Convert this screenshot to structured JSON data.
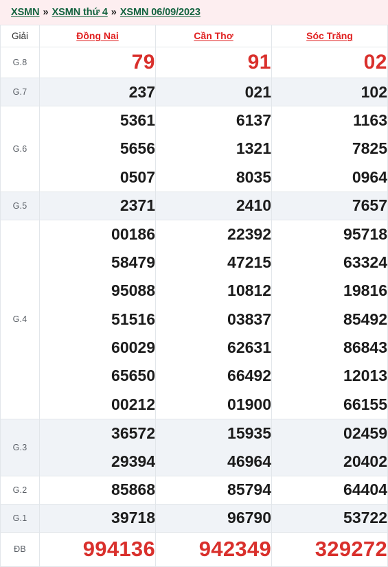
{
  "breadcrumb": {
    "items": [
      "XSMN",
      "XSMN thứ 4",
      "XSMN 06/09/2023"
    ],
    "separator": "»"
  },
  "colors": {
    "breadcrumb_bg": "#fdeef0",
    "breadcrumb_link": "#14633f",
    "province_link": "#e02020",
    "highlight_number": "#d9302c",
    "number": "#1c1c1c",
    "alt_row_bg": "#f0f3f7",
    "border": "#e2e6ea"
  },
  "table": {
    "headers": {
      "grade": "Giải",
      "provinces": [
        "Đồng Nai",
        "Cần Thơ",
        "Sóc Trăng"
      ]
    },
    "rows": [
      {
        "grade": "G.8",
        "values": {
          "dong_nai": "79",
          "can_tho": "91",
          "soc_trang": "02"
        }
      },
      {
        "grade": "G.7",
        "values": {
          "dong_nai": "237",
          "can_tho": "021",
          "soc_trang": "102"
        }
      },
      {
        "grade": "G.6",
        "values": {
          "dong_nai": "5361\n5656\n0507",
          "can_tho": "6137\n1321\n8035",
          "soc_trang": "1163\n7825\n0964"
        }
      },
      {
        "grade": "G.5",
        "values": {
          "dong_nai": "2371",
          "can_tho": "2410",
          "soc_trang": "7657"
        }
      },
      {
        "grade": "G.4",
        "values": {
          "dong_nai": "00186\n58479\n95088\n51516\n60029\n65650\n00212",
          "can_tho": "22392\n47215\n10812\n03837\n62631\n66492\n01900",
          "soc_trang": "95718\n63324\n19816\n85492\n86843\n12013\n66155"
        }
      },
      {
        "grade": "G.3",
        "values": {
          "dong_nai": "36572\n29394",
          "can_tho": "15935\n46964",
          "soc_trang": "02459\n20402"
        }
      },
      {
        "grade": "G.2",
        "values": {
          "dong_nai": "85868",
          "can_tho": "85794",
          "soc_trang": "64404"
        }
      },
      {
        "grade": "G.1",
        "values": {
          "dong_nai": "39718",
          "can_tho": "96790",
          "soc_trang": "53722"
        }
      },
      {
        "grade": "ĐB",
        "values": {
          "dong_nai": "994136",
          "can_tho": "942349",
          "soc_trang": "329272"
        }
      }
    ]
  }
}
